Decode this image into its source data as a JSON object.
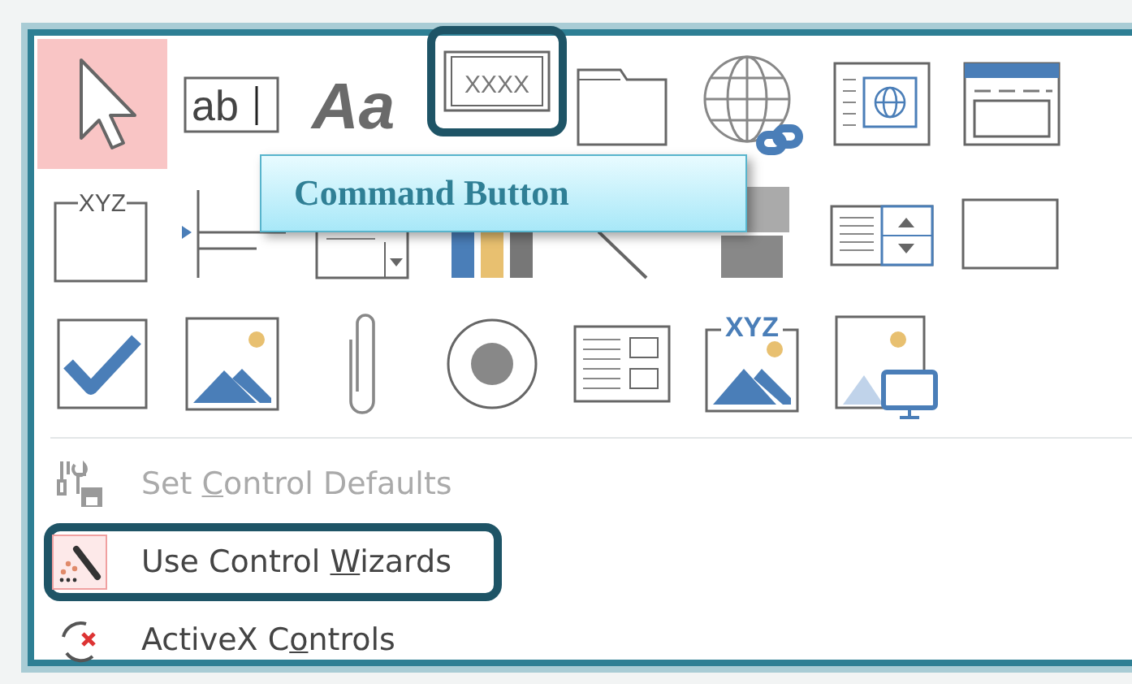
{
  "tools": [
    {
      "kind": "pointer",
      "selected": true,
      "highlighted": false
    },
    {
      "kind": "textbox",
      "text": "ab",
      "selected": false,
      "highlighted": false
    },
    {
      "kind": "label",
      "text": "Aa",
      "selected": false,
      "highlighted": false
    },
    {
      "kind": "button",
      "text": "XXXX",
      "selected": false,
      "highlighted": true
    },
    {
      "kind": "folder",
      "selected": false,
      "highlighted": false
    },
    {
      "kind": "hyperlink",
      "selected": false,
      "highlighted": false
    },
    {
      "kind": "browser",
      "selected": false,
      "highlighted": false
    },
    {
      "kind": "navigation",
      "selected": false,
      "highlighted": false
    },
    {
      "kind": "group",
      "text": "XYZ",
      "selected": false,
      "highlighted": false
    },
    {
      "kind": "pagebreak",
      "selected": false,
      "highlighted": false
    },
    {
      "kind": "combo",
      "selected": false,
      "highlighted": false
    },
    {
      "kind": "chart",
      "selected": false,
      "highlighted": false
    },
    {
      "kind": "line",
      "selected": false,
      "highlighted": false
    },
    {
      "kind": "toggle",
      "selected": false,
      "highlighted": false
    },
    {
      "kind": "listbox",
      "selected": false,
      "highlighted": false
    },
    {
      "kind": "rectangle",
      "selected": false,
      "highlighted": false
    },
    {
      "kind": "checkbox",
      "selected": false,
      "highlighted": false
    },
    {
      "kind": "image",
      "selected": false,
      "highlighted": false
    },
    {
      "kind": "attachment",
      "selected": false,
      "highlighted": false
    },
    {
      "kind": "option",
      "selected": false,
      "highlighted": false
    },
    {
      "kind": "subform",
      "selected": false,
      "highlighted": false
    },
    {
      "kind": "bound",
      "text": "XYZ",
      "selected": false,
      "highlighted": false
    },
    {
      "kind": "unbound",
      "selected": false,
      "highlighted": false
    }
  ],
  "tooltip": "Command Button",
  "menu": [
    {
      "kind": "defaults",
      "before": "Set ",
      "access_key": "C",
      "after": "ontrol Defaults",
      "disabled": true,
      "checked": false,
      "highlighted": false
    },
    {
      "kind": "wizards",
      "before": "Use Control ",
      "access_key": "W",
      "after": "izards",
      "disabled": false,
      "checked": true,
      "highlighted": true
    },
    {
      "kind": "activex",
      "before": "ActiveX C",
      "access_key": "o",
      "after": "ntrols",
      "disabled": false,
      "checked": false,
      "highlighted": false
    }
  ]
}
